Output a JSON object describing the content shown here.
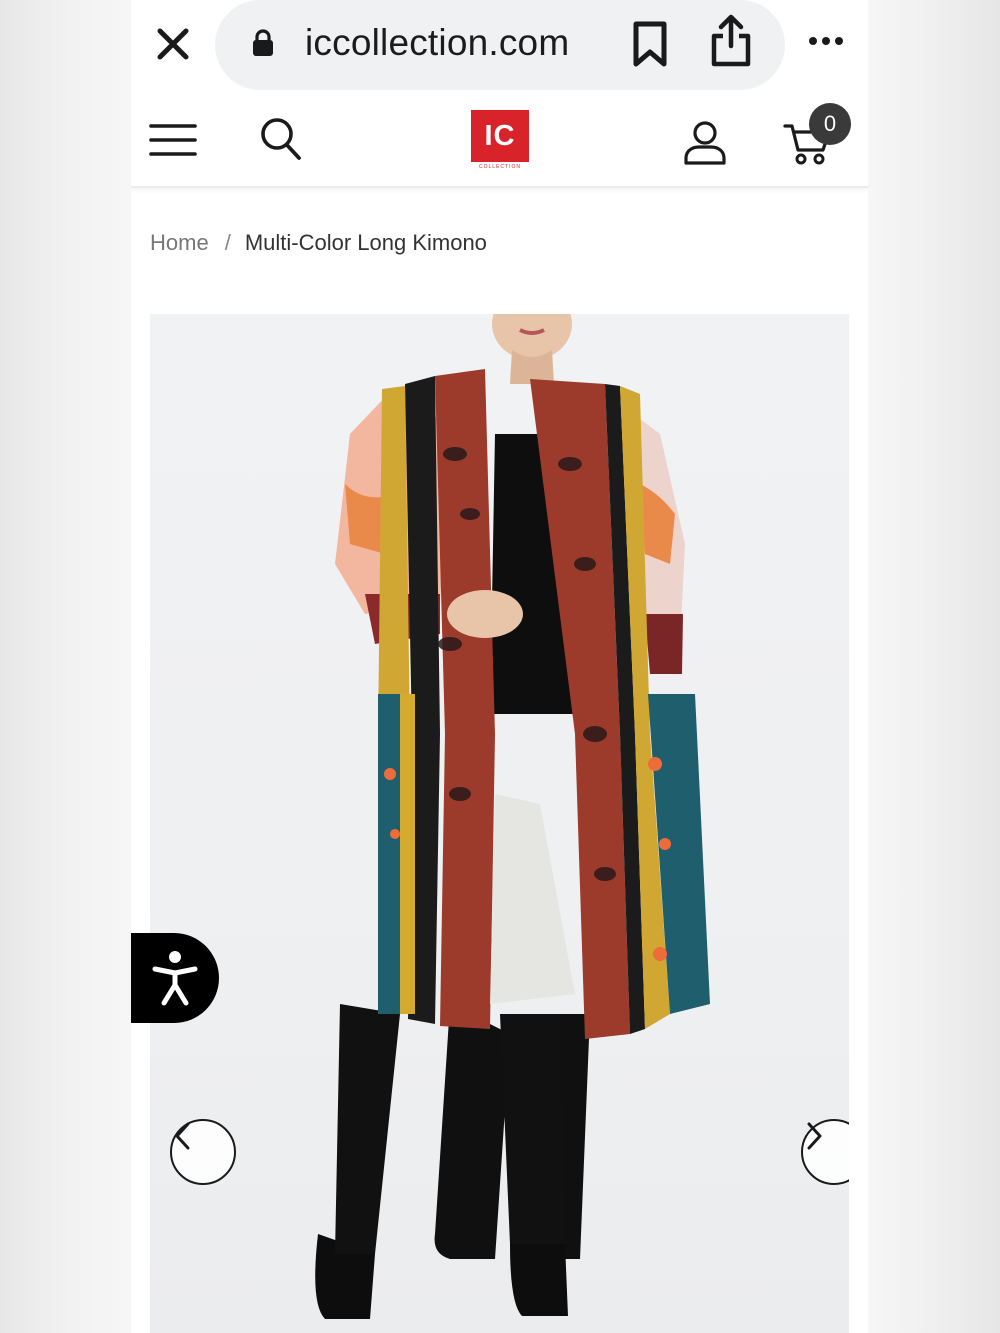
{
  "browser": {
    "url": "iccollection.com",
    "icons": [
      "close-icon",
      "lock-icon",
      "bookmark-icon",
      "share-icon",
      "more-icon"
    ]
  },
  "header": {
    "logo_text": "IC",
    "logo_subtext": "COLLECTION",
    "cart_count": "0",
    "icons": [
      "menu-icon",
      "search-icon",
      "account-icon",
      "cart-icon"
    ]
  },
  "breadcrumb": {
    "home": "Home",
    "separator": "/",
    "current": "Multi-Color Long Kimono"
  },
  "product_image": {
    "alt": "Multi-Color Long Kimono",
    "icons": [
      "chevron-left-icon",
      "chevron-right-icon"
    ]
  },
  "accessibility": {
    "icon": "accessibility-icon"
  },
  "colors": {
    "brand_red": "#d8232a",
    "badge_bg": "#3a3a3a",
    "text_dark": "#333333",
    "text_muted": "#777777"
  }
}
